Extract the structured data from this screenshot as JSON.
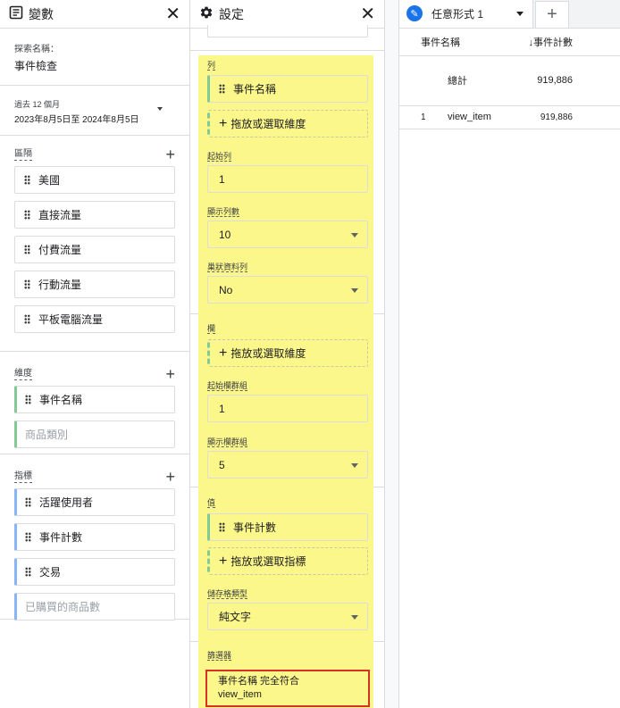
{
  "variables": {
    "title": "變數",
    "exploration_name_label": "探索名稱：",
    "exploration_name": "事件檢查",
    "date_range_label": "過去 12 個月",
    "date_range": "2023年8月5日至 2024年8月5日",
    "segments_title": "區隔",
    "segments": [
      "美國",
      "直接流量",
      "付費流量",
      "行動流量",
      "平板電腦流量"
    ],
    "dimensions_title": "維度",
    "dimensions": [
      "事件名稱",
      "商品類別"
    ],
    "metrics_title": "指標",
    "metrics": [
      "活躍使用者",
      "事件計數",
      "交易",
      "已購買的商品數"
    ]
  },
  "settings": {
    "title": "設定",
    "rows_title": "列",
    "rows_dimension": "事件名稱",
    "drop_dimension": "拖放或選取維度",
    "start_row_label": "起始列",
    "start_row": "1",
    "show_rows_label": "顯示列數",
    "show_rows": "10",
    "nested_rows_label": "巢狀資料列",
    "nested_rows": "No",
    "columns_title": "欄",
    "drop_dimension_col": "拖放或選取維度",
    "start_col_label": "起始欄群組",
    "start_col": "1",
    "show_cols_label": "顯示欄群組",
    "show_cols": "5",
    "values_title": "值",
    "values_metric": "事件計數",
    "drop_metric": "拖放或選取指標",
    "cell_type_label": "儲存格類型",
    "cell_type": "純文字",
    "filters_title": "篩選器",
    "filter_text": "事件名稱 完全符合",
    "filter_value": "view_item"
  },
  "output": {
    "tab_name": "任意形式 1",
    "col_dimension": "事件名稱",
    "col_metric": "事件計數",
    "total_label": "總計",
    "total_value": "919,886",
    "rows": [
      {
        "index": "1",
        "name": "view_item",
        "value": "919,886"
      }
    ]
  },
  "colors": {
    "highlight": "#fcf78a",
    "filter_border": "#d93025",
    "dimension_accent": "#81c995",
    "metric_accent": "#8ab4f8",
    "tab_icon": "#1a73e8"
  },
  "icons": {
    "variables": "panel-icon",
    "settings": "gear-icon",
    "close": "close-icon",
    "add": "plus-icon",
    "sort": "arrow-down-icon"
  }
}
